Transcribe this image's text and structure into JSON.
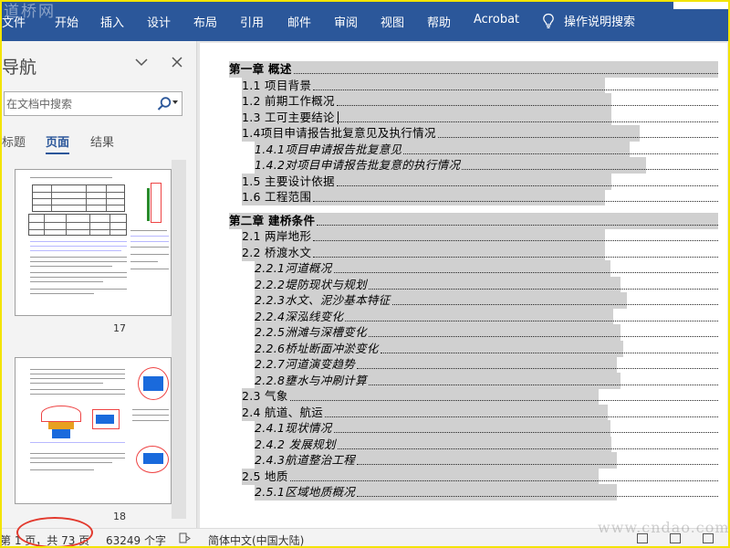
{
  "watermark_top": "道桥网",
  "watermark_bottom": "www.cndao.com",
  "ribbon": {
    "tabs": [
      "文件",
      "开始",
      "插入",
      "设计",
      "布局",
      "引用",
      "邮件",
      "审阅",
      "视图",
      "帮助",
      "Acrobat"
    ],
    "tell_me": "操作说明搜索",
    "tell_me_icon": "lightbulb-icon"
  },
  "nav_pane": {
    "title": "导航",
    "search_placeholder": "在文档中搜索",
    "tabs": [
      "标题",
      "页面",
      "结果"
    ],
    "active_tab": "页面",
    "thumbnails": [
      {
        "page_number": "17"
      },
      {
        "page_number": "18"
      }
    ]
  },
  "toc": [
    {
      "level": 1,
      "text": "第一章  概述"
    },
    {
      "level": 2,
      "text": "1.1 项目背景"
    },
    {
      "level": 2,
      "text": "1.2 前期工作概况"
    },
    {
      "level": 2,
      "text": "1.3 工可主要结论"
    },
    {
      "level": 2,
      "text": "1.4项目申请报告批复意见及执行情况"
    },
    {
      "level": 3,
      "text": "1.4.1项目申请报告批复意见"
    },
    {
      "level": 3,
      "text": "1.4.2对项目申请报告批复意的执行情况"
    },
    {
      "level": 2,
      "text": "1.5 主要设计依据"
    },
    {
      "level": 2,
      "text": "1.6 工程范围"
    },
    {
      "level": 1,
      "text": "第二章  建桥条件"
    },
    {
      "level": 2,
      "text": "2.1 两岸地形"
    },
    {
      "level": 2,
      "text": "2.2 桥渡水文"
    },
    {
      "level": 3,
      "text": "2.2.1河道概况"
    },
    {
      "level": 3,
      "text": "2.2.2堤防现状与规划"
    },
    {
      "level": 3,
      "text": "2.2.3水文、泥沙基本特征"
    },
    {
      "level": 3,
      "text": "2.2.4深泓线变化"
    },
    {
      "level": 3,
      "text": "2.2.5洲滩与深槽变化"
    },
    {
      "level": 3,
      "text": "2.2.6桥址断面冲淤变化"
    },
    {
      "level": 3,
      "text": "2.2.7河道演变趋势"
    },
    {
      "level": 3,
      "text": "2.2.8壅水与冲刷计算"
    },
    {
      "level": 2,
      "text": "2.3 气象"
    },
    {
      "level": 2,
      "text": "2.4 航道、航运"
    },
    {
      "level": 3,
      "text": "2.4.1现状情况"
    },
    {
      "level": 3,
      "text": "2.4.2 发展规划"
    },
    {
      "level": 3,
      "text": "2.4.3航道整治工程"
    },
    {
      "level": 2,
      "text": "2.5 地质"
    },
    {
      "level": 3,
      "text": "2.5.1区域地质概况"
    }
  ],
  "status_bar": {
    "page_info": "第 1 页，共 73 页",
    "word_count": "63249 个字",
    "language": "简体中文(中国大陆)",
    "highlight_color": "#e23a2e"
  }
}
